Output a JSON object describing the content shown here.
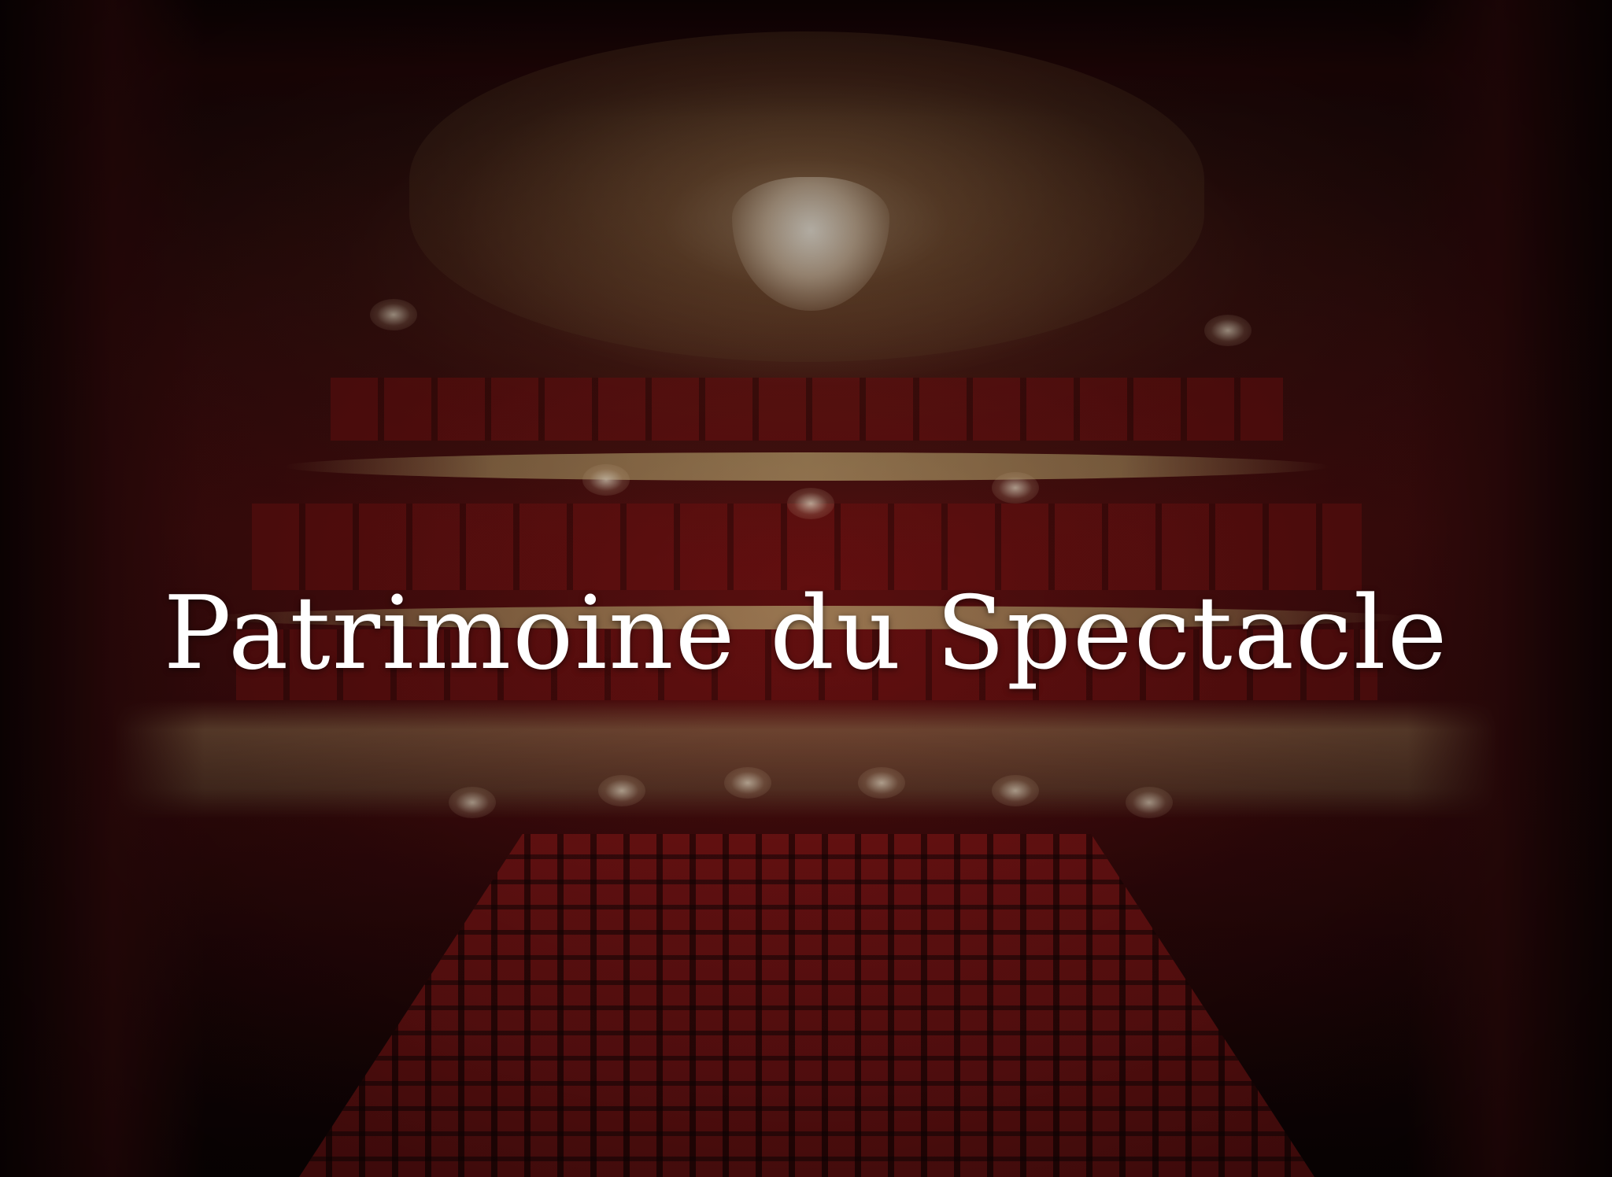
{
  "hero": {
    "title": "Patrimoine du Spectacle",
    "title_color": "#ffffff",
    "background_subject": "theatre-auditorium-photo"
  }
}
